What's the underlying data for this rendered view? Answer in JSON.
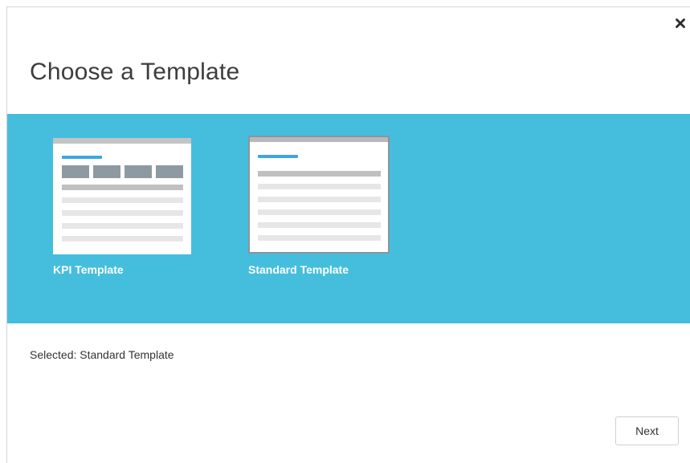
{
  "dialog": {
    "title": "Choose a Template",
    "close_icon": "close-icon"
  },
  "colors": {
    "band": "#45bedd",
    "accent": "#3ea6e3",
    "card_label": "#ffffff",
    "selected_border": "#8a959c"
  },
  "templates": [
    {
      "label": "KPI Template",
      "selected": false
    },
    {
      "label": "Standard Template",
      "selected": true
    }
  ],
  "selection": {
    "text": "Selected: Standard Template"
  },
  "footer": {
    "next_label": "Next"
  }
}
